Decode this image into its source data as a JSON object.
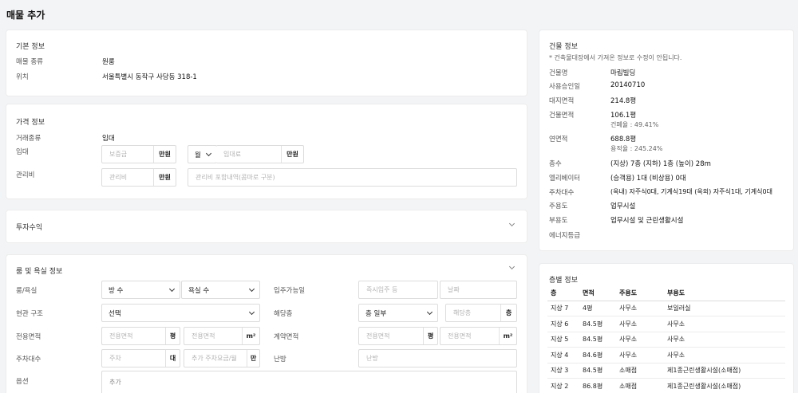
{
  "page_title": "매물 추가",
  "basic": {
    "title": "기본 정보",
    "type_label": "매물 종류",
    "type_value": "원룸",
    "location_label": "위치",
    "location_value": "서울특별시 동작구 사당동 318-1"
  },
  "price": {
    "title": "가격 정보",
    "deal_label": "거래종류",
    "deal_value": "임대",
    "rent_label": "임대",
    "deposit_placeholder": "보증금",
    "deposit_unit": "만원",
    "period_value": "월",
    "rent_placeholder": "임대료",
    "rent_unit": "만원",
    "fee_label": "관리비",
    "fee_placeholder": "관리비",
    "fee_unit": "만원",
    "fee_detail_placeholder": "관리비 포함내역(콤마로 구분)"
  },
  "investment": {
    "title": "투자수익"
  },
  "room": {
    "title": "룸 및 욕실 정보",
    "rooms_label": "룸/욕실",
    "rooms_select": "방 수",
    "baths_select": "욕실 수",
    "movein_label": "입주가능일",
    "movein_placeholder": "즉시입주 등",
    "date_placeholder": "날짜",
    "entrance_label": "현관 구조",
    "entrance_select": "선택",
    "floor_label": "해당층",
    "floor_select": "층 일부",
    "floor_placeholder": "해당층",
    "floor_unit": "층",
    "exclusive_label": "전용면적",
    "area_placeholder": "전용면적",
    "pyeong_unit": "평",
    "sqm_unit": "m²",
    "contract_label": "계약면적",
    "parking_label": "주차대수",
    "parking_placeholder": "주차",
    "parking_unit": "대",
    "parking_fee_placeholder": "추가 주차요금/월",
    "parking_fee_unit": "만",
    "heating_label": "난방",
    "heating_placeholder": "난방",
    "options_label": "옵션",
    "options_placeholder": "추가"
  },
  "building": {
    "title": "건물 정보",
    "note": "* 건축물대장에서 가져온 정보로 수정이 안됩니다.",
    "name_label": "건물명",
    "name_value": "마립빌딩",
    "approval_label": "사용승인일",
    "approval_value": "20140710",
    "land_label": "대지면적",
    "land_value": "214.8평",
    "bldg_area_label": "건물면적",
    "bldg_area_value": "106.1평",
    "coverage": "건폐율 : 49.41%",
    "total_area_label": "연면적",
    "total_area_value": "688.8평",
    "far": "용적율 : 245.24%",
    "floors_label": "층수",
    "floors_value": "(지상) 7층 (지하) 1층 (높이) 28m",
    "elevator_label": "엘리베이터",
    "elevator_value": "(승객용) 1대 (비상용) 0대",
    "parking_label": "주차대수",
    "parking_value": "(옥내) 자주식0대, 기계식19대 (옥외) 자주식1대, 기계식0대",
    "main_use_label": "주용도",
    "main_use_value": "업무시설",
    "sub_use_label": "부용도",
    "sub_use_value": "업무시설 및 근린생활시설",
    "energy_label": "에너지등급"
  },
  "floor_info": {
    "title": "층별 정보",
    "headers": [
      "층",
      "면적",
      "주용도",
      "부용도"
    ],
    "rows": [
      [
        "지상 7",
        "4평",
        "사무소",
        "보일러실"
      ],
      [
        "지상 6",
        "84.5평",
        "사무소",
        "사무소"
      ],
      [
        "지상 5",
        "84.5평",
        "사무소",
        "사무소"
      ],
      [
        "지상 4",
        "84.6평",
        "사무소",
        "사무소"
      ],
      [
        "지상 3",
        "84.5평",
        "소매점",
        "제1종근린생활시설(소매점)"
      ],
      [
        "지상 2",
        "86.8평",
        "소매점",
        "제1종근린생활시설(소매점)"
      ]
    ]
  }
}
